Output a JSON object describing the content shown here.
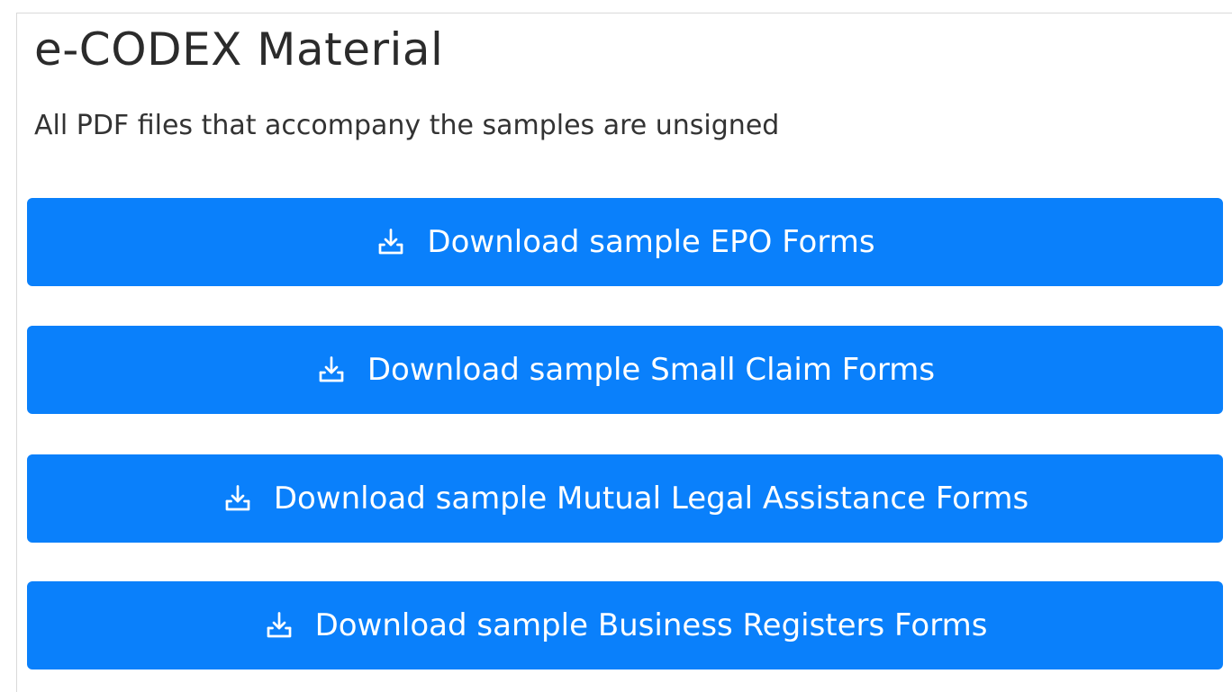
{
  "header": {
    "title": "e-CODEX Material",
    "subtitle": "All PDF files that accompany the samples are unsigned"
  },
  "downloads": [
    {
      "label": "Download sample EPO Forms",
      "icon": "download-icon"
    },
    {
      "label": "Download sample Small Claim Forms",
      "icon": "download-icon"
    },
    {
      "label": "Download sample Mutual Legal Assistance Forms",
      "icon": "download-icon"
    },
    {
      "label": "Download sample Business Registers Forms",
      "icon": "download-icon"
    }
  ],
  "colors": {
    "button_bg": "#0a80fb",
    "button_text": "#ffffff",
    "title_text": "#2b2b2b",
    "body_text": "#333333"
  }
}
